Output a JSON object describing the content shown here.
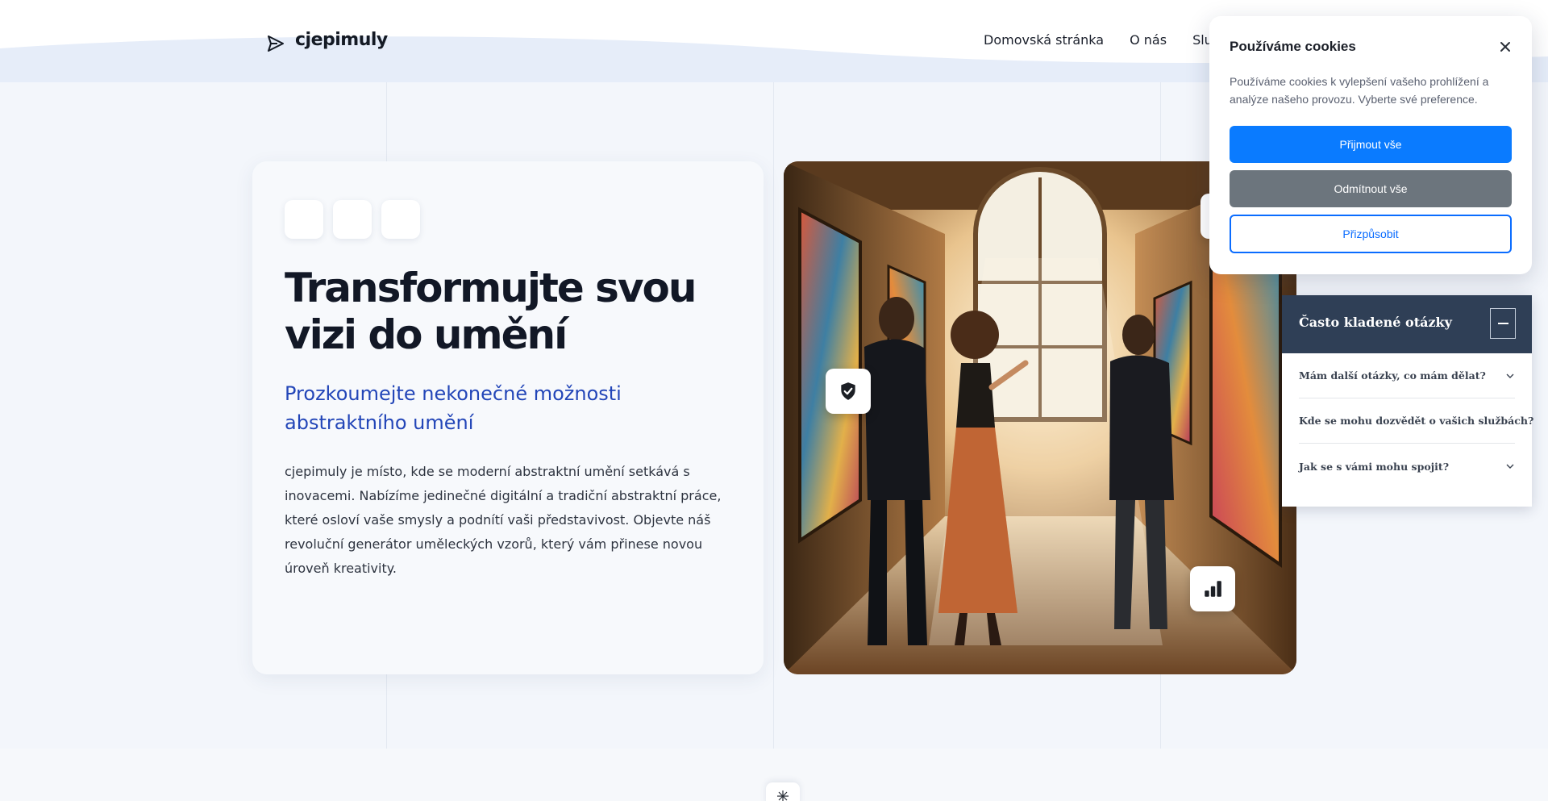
{
  "brand": {
    "name": "cjepimuly",
    "logo_icon": "paper-plane-icon"
  },
  "nav": {
    "items": [
      {
        "label": "Domovská stránka"
      },
      {
        "label": "O nás"
      },
      {
        "label": "Služby"
      }
    ]
  },
  "hero": {
    "title": "Transformujte svou vizi do umění",
    "subtitle": "Prozkoumejte nekonečné možnosti abstraktního umění",
    "description": "cjepimuly je místo, kde se moderní abstraktní umění setkává s inovacemi. Nabízíme jedinečné digitální a tradiční abstraktní práce, které osloví vaše smysly a podnítí vaši představivost. Objevte náš revoluční generátor uměleckých vzorů, který vám přinese novou úroveň kreativity."
  },
  "photo": {
    "badges": [
      {
        "icon": "shield-check-icon"
      },
      {
        "icon": "bar-chart-icon"
      }
    ]
  },
  "cookie": {
    "title": "Používáme cookies",
    "text": "Používáme cookies k vylepšení vašeho prohlížení a analýze našeho provozu. Vyberte své preference.",
    "accept_label": "Přijmout vše",
    "reject_label": "Odmítnout vše",
    "customize_label": "Přizpůsobit",
    "colors": {
      "accept": "#0a7bff",
      "reject": "#6c757d"
    }
  },
  "faq": {
    "title": "Často kladené otázky",
    "items": [
      {
        "question": "Mám další otázky, co mám dělat?"
      },
      {
        "question": "Kde se mohu dozvědět o vašich službách?"
      },
      {
        "question": "Jak se s vámi mohu spojit?"
      }
    ]
  },
  "bottom": {
    "icon": "sparkle-icon"
  }
}
